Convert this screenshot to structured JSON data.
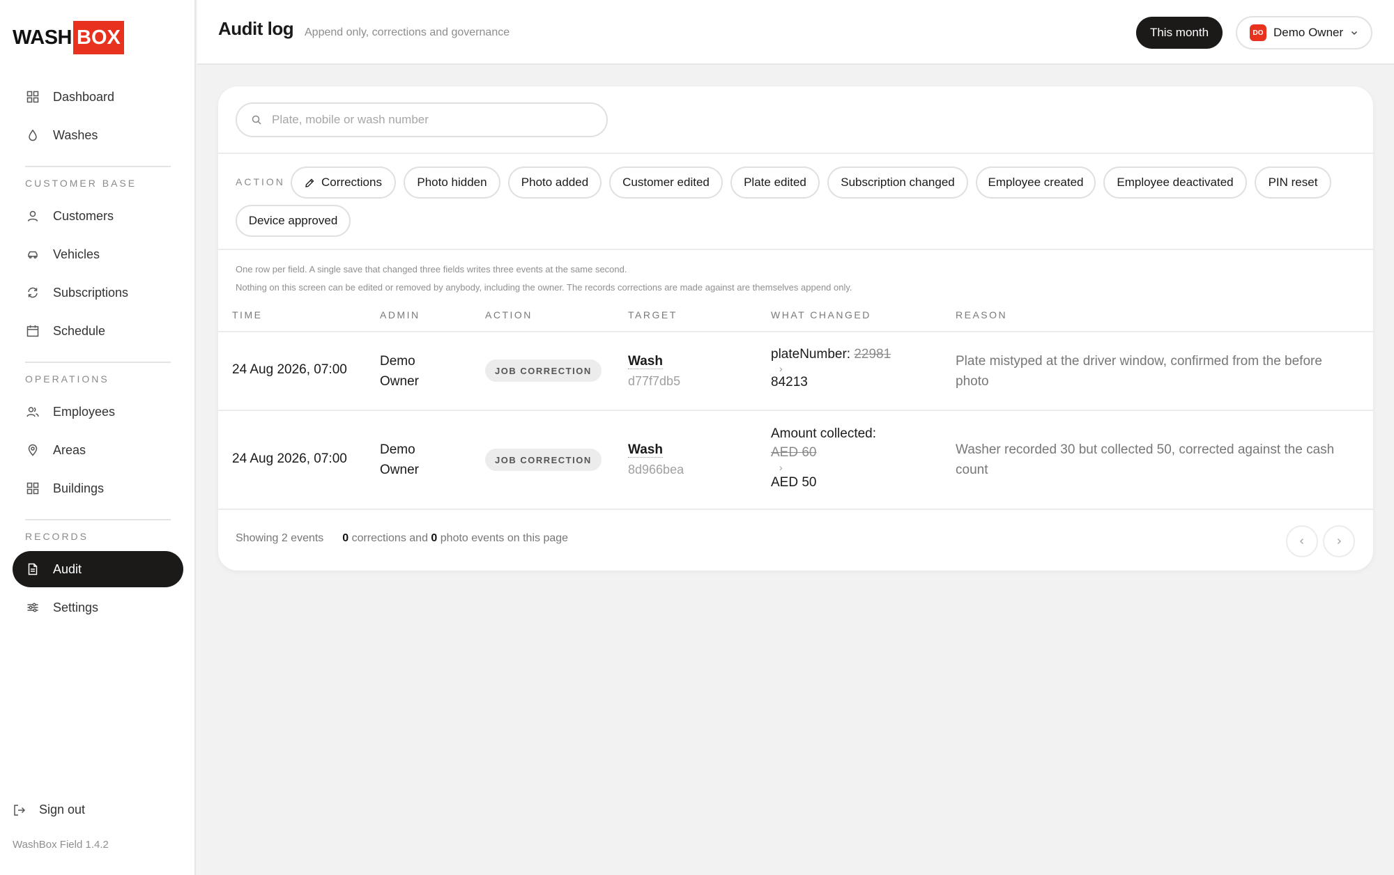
{
  "brand": {
    "wash": "WASH",
    "box": "BOX",
    "accent": "#e8321e"
  },
  "sidebar": {
    "primary": [
      {
        "label": "Dashboard",
        "icon": "grid-icon"
      },
      {
        "label": "Washes",
        "icon": "droplet-icon"
      }
    ],
    "sections": [
      {
        "title": "CUSTOMER BASE",
        "items": [
          {
            "label": "Customers",
            "icon": "user-icon"
          },
          {
            "label": "Vehicles",
            "icon": "car-icon"
          },
          {
            "label": "Subscriptions",
            "icon": "refresh-icon"
          },
          {
            "label": "Schedule",
            "icon": "calendar-icon"
          }
        ]
      },
      {
        "title": "OPERATIONS",
        "items": [
          {
            "label": "Employees",
            "icon": "users-icon"
          },
          {
            "label": "Areas",
            "icon": "pin-icon"
          },
          {
            "label": "Buildings",
            "icon": "grid-icon"
          }
        ]
      },
      {
        "title": "RECORDS",
        "items": [
          {
            "label": "Audit",
            "icon": "document-icon",
            "active": true
          },
          {
            "label": "Settings",
            "icon": "sliders-icon"
          }
        ]
      }
    ],
    "signout": "Sign out",
    "version": "WashBox Field 1.4.2"
  },
  "header": {
    "title": "Audit log",
    "subtitle": "Append only, corrections and governance",
    "period": "This month",
    "user": {
      "initials": "DO",
      "name": "Demo Owner"
    }
  },
  "search": {
    "placeholder": "Plate, mobile or wash number"
  },
  "filters": {
    "label": "ACTION",
    "chips": [
      "Corrections",
      "Photo hidden",
      "Photo added",
      "Customer edited",
      "Plate edited",
      "Subscription changed",
      "Employee created",
      "Employee deactivated",
      "PIN reset",
      "Device approved"
    ]
  },
  "notes": [
    "One row per field. A single save that changed three fields writes three events at the same second.",
    "Nothing on this screen can be edited or removed by anybody, including the owner. The records corrections are made against are themselves append only."
  ],
  "table": {
    "columns": [
      "TIME",
      "ADMIN",
      "ACTION",
      "TARGET",
      "WHAT CHANGED",
      "REASON"
    ],
    "rows": [
      {
        "time": "24 Aug 2026, 07:00",
        "admin_first": "Demo",
        "admin_last": "Owner",
        "action": "JOB CORRECTION",
        "target_type": "Wash",
        "target_id": "d77f7db5",
        "field": "plateNumber:",
        "old": "22981",
        "arrow": "›",
        "new": "84213",
        "reason_line1": "Plate mistyped at the driver window, confirmed from the before",
        "reason_line2": "photo"
      },
      {
        "time": "24 Aug 2026, 07:00",
        "admin_first": "Demo",
        "admin_last": "Owner",
        "action": "JOB CORRECTION",
        "target_type": "Wash",
        "target_id": "8d966bea",
        "field": "Amount collected:",
        "old": "AED 60",
        "arrow": "›",
        "new": "AED 50",
        "reason_line1": "Washer recorded 30 but collected 50, corrected against the cash",
        "reason_line2": "count"
      }
    ]
  },
  "footer": {
    "showing": "Showing 2 events",
    "corrections_count": "0",
    "corrections_text": "corrections and",
    "photo_count": "0",
    "photo_text": "photo events on this page"
  }
}
